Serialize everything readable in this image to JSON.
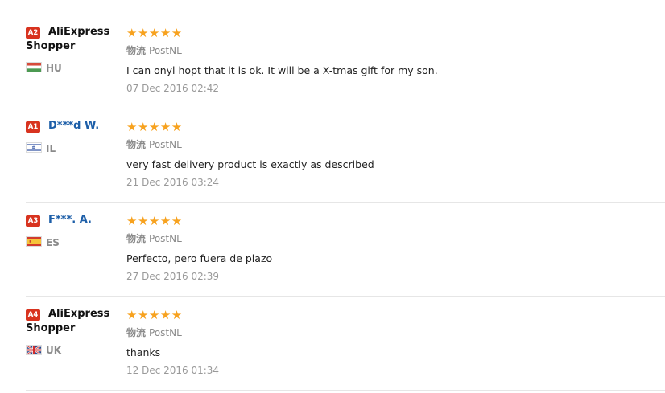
{
  "colors": {
    "star": "#f7a21f",
    "badge": "#d8331f",
    "username_link": "#1c5ea8",
    "username_plain": "#111111",
    "muted_text": "#8a8a8a",
    "date_text": "#999999",
    "divider": "#e6e6e6"
  },
  "reviews": [
    {
      "level": "A2",
      "name_line1": "AliExpress",
      "name_line2": "Shopper",
      "flag_icon": "hungary-flag-icon",
      "country": "HU",
      "rating": 5,
      "stars": "★★★★★",
      "logistics_label": "物流",
      "logistics_value": "PostNL",
      "text": "I can onyl hopt that it is ok. It will be a X-tmas gift for my son.",
      "date": "07 Dec 2016 02:42"
    },
    {
      "level": "A1",
      "name_line1": "D***d W.",
      "flag_icon": "israel-flag-icon",
      "country": "IL",
      "rating": 5,
      "stars": "★★★★★",
      "logistics_label": "物流",
      "logistics_value": "PostNL",
      "text": "very fast delivery product is exactly as described",
      "date": "21 Dec 2016 03:24"
    },
    {
      "level": "A3",
      "name_line1": "F***. A.",
      "flag_icon": "spain-flag-icon",
      "country": "ES",
      "rating": 5,
      "stars": "★★★★★",
      "logistics_label": "物流",
      "logistics_value": "PostNL",
      "text": "Perfecto, pero fuera de plazo",
      "date": "27 Dec 2016 02:39"
    },
    {
      "level": "A4",
      "name_line1": "AliExpress",
      "name_line2": "Shopper",
      "flag_icon": "uk-flag-icon",
      "country": "UK",
      "rating": 5,
      "stars": "★★★★★",
      "logistics_label": "物流",
      "logistics_value": "PostNL",
      "text": "thanks",
      "date": "12 Dec 2016 01:34"
    }
  ]
}
